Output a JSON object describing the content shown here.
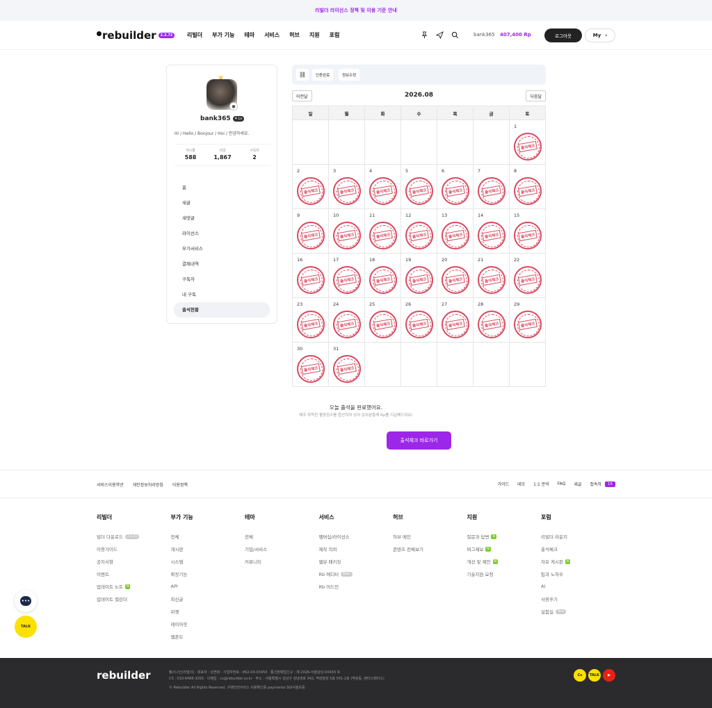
{
  "notice": "리빌더 라이선스 정책 및 이용 기준 안내",
  "header": {
    "logo": "rebuilder",
    "version": "2.2.72",
    "nav": [
      "리빌더",
      "부가 기능",
      "테마",
      "서비스",
      "허브",
      "지원",
      "포럼"
    ],
    "username": "bank365",
    "points": "407,400 Rp",
    "logout": "로그아웃",
    "my": "My"
  },
  "profile": {
    "name": "bank365",
    "level": "4 Lv",
    "greeting": "Hi / Hello / Bonjour / Hoi / 안녕하세요.",
    "stats": [
      {
        "label": "게시물",
        "value": "588"
      },
      {
        "label": "댓글",
        "value": "1,867"
      },
      {
        "label": "구독자",
        "value": "2"
      }
    ],
    "menu": [
      "홈",
      "새글",
      "새댓글",
      "라이선스",
      "부가서비스",
      "결제내역",
      "구독자",
      "내 구독",
      "출석현황"
    ]
  },
  "toolbar": {
    "btn1": "인증완료",
    "btn2": "정보수정"
  },
  "calendar": {
    "prev": "이전달",
    "next": "다음달",
    "month": "2026.08",
    "weekdays": [
      "일",
      "월",
      "화",
      "수",
      "목",
      "금",
      "토"
    ],
    "stamp_text": "출석체크",
    "first_weekday": 6,
    "days_in_month": 31,
    "stamped_days": [
      1,
      2,
      3,
      4,
      5,
      6,
      7,
      8,
      9,
      10,
      11,
      12,
      13,
      14,
      15,
      16,
      17,
      18,
      19,
      20,
      21,
      22,
      23,
      24,
      25,
      26,
      27,
      28,
      29,
      30,
      31
    ]
  },
  "status": {
    "title": "오늘 출석을 완료했어요.",
    "sub": "매주 획득한 활동점수를 합산하여 상위 순위분들께 Rp를 지급해드려요!",
    "cta": "출석체크 바로가기"
  },
  "footer_bar": {
    "left": [
      "서비스이용약관",
      "개인정보처리방침",
      "이용정책"
    ],
    "right": [
      "가이드",
      "데모",
      "1:1 문의",
      "FAQ",
      "새글",
      "접속자"
    ],
    "online": "15"
  },
  "footer_cols": [
    {
      "title": "리빌더",
      "items": [
        "빌더 다운로드",
        "이용가이드",
        "공지사항",
        "이벤트",
        "업데이트 노트",
        "업데이트 캘린더"
      ]
    },
    {
      "title": "부가 기능",
      "items": [
        "전체",
        "게시판",
        "시스템",
        "확장기능",
        "API",
        "최신글",
        "위젯",
        "레이아웃",
        "웹폰트"
      ]
    },
    {
      "title": "테마",
      "items": [
        "전체",
        "기업/서비스",
        "커뮤니티"
      ]
    },
    {
      "title": "서비스",
      "items": [
        "멤버십/라이선스",
        "제작 의뢰",
        "웹뷰 패키징",
        "Rb 에디터",
        "Rb 어드민"
      ]
    },
    {
      "title": "허브",
      "items": [
        "허브 메인",
        "콘텐츠 전체보기"
      ]
    },
    {
      "title": "지원",
      "items": [
        "질문과 답변",
        "버그제보",
        "개선 및 제안",
        "기술지원 요청"
      ]
    },
    {
      "title": "포럼",
      "items": [
        "리빌더 라운지",
        "출석체크",
        "자유 게시판",
        "팁과 노하우",
        "AI",
        "사용후기",
        "실험실"
      ]
    }
  ],
  "footer_tags": {
    "download_version": "2.2.72",
    "new": "N",
    "beta": "Beta",
    "lab": "Test"
  },
  "footer": {
    "logo": "rebuilder",
    "line1": "펌스나인(리빌더) · 대표자 : 남연화 · 사업자번호 : 892-03-03450 · 통신판매업신고 : 제 2026-서울강남-00430 호",
    "line2": "CS : 010-6466-3355 · 이메일 : cs@rebuilder.co.kr · 주소 : 서울특별시 강남구 강남대로 342, 역삼빌딩 5층 501-2호 (역삼동, 렌터스페이스)",
    "line3": "© Rebuilder All Rights Reserved.   구매안전서비스 이용확인증   paymenta   SGI서울보증",
    "social": [
      "Cs",
      "TALK",
      "▶"
    ]
  },
  "float": {
    "chat": "•••",
    "kakao": "TALK"
  }
}
